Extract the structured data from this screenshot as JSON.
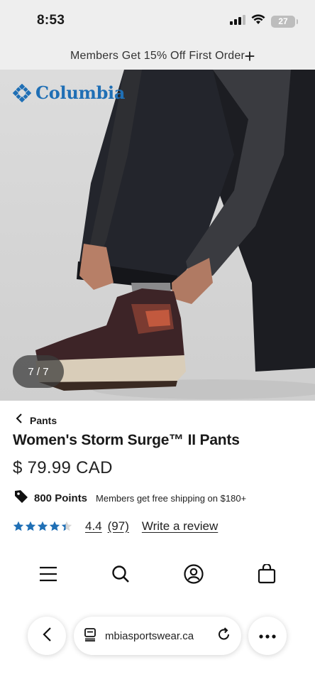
{
  "status_bar": {
    "time": "8:53",
    "battery": "27",
    "icons": [
      "signal-icon",
      "wifi-icon",
      "battery-icon"
    ]
  },
  "promo": {
    "text": "Members Get 15% Off First Order",
    "expand_icon": "plus-icon"
  },
  "hero": {
    "brand": "Columbia",
    "image_counter": "7 / 7",
    "colors": {
      "brand_blue": "#1f6fb5"
    }
  },
  "product": {
    "breadcrumb": "Pants",
    "title": "Women's Storm Surge™ II Pants",
    "price": "$ 79.99 CAD",
    "points": "800 Points",
    "shipping_note": "Members get free shipping on $180+",
    "rating": {
      "score_text": "4.4",
      "score": 4.4,
      "max": 5,
      "count_text": "(97)",
      "write_review": "Write a review",
      "star_color": "#1f6fb5"
    }
  },
  "bottom_nav": {
    "items": [
      "menu-icon",
      "search-icon",
      "account-icon",
      "bag-icon"
    ]
  },
  "browser": {
    "url": "mbiasportswear.ca",
    "back_icon": "chevron-left-icon",
    "tabs_icon": "reader-icon",
    "reload_icon": "reload-icon",
    "more_icon": "more-icon"
  }
}
